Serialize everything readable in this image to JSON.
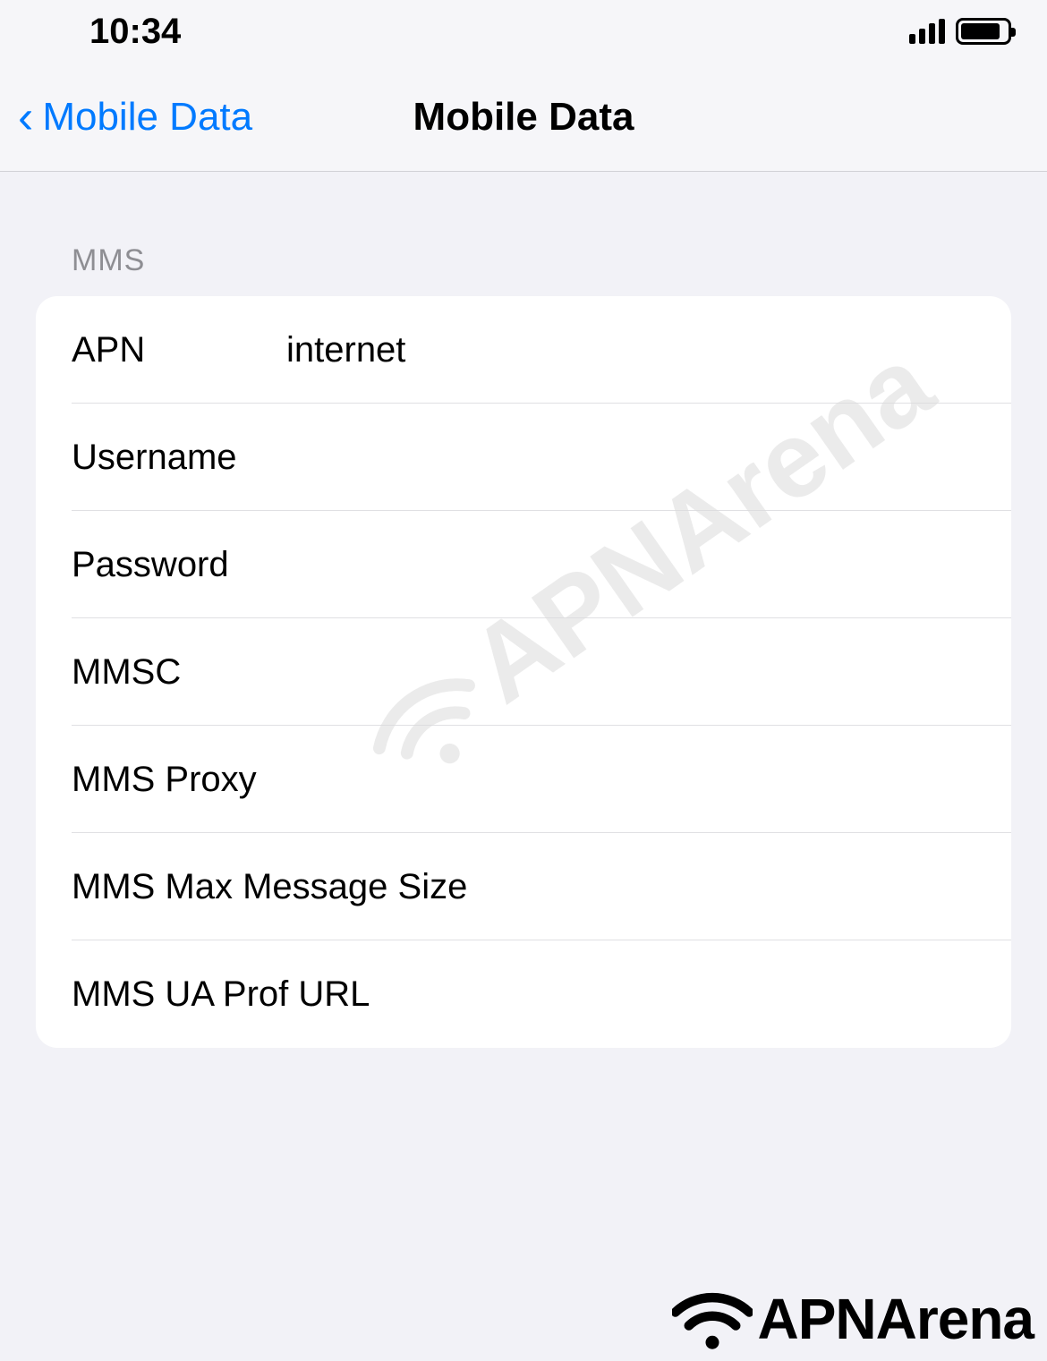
{
  "statusBar": {
    "time": "10:34"
  },
  "navBar": {
    "backLabel": "Mobile Data",
    "title": "Mobile Data"
  },
  "section": {
    "header": "MMS",
    "rows": {
      "apn": {
        "label": "APN",
        "value": "internet"
      },
      "username": {
        "label": "Username",
        "value": ""
      },
      "password": {
        "label": "Password",
        "value": ""
      },
      "mmsc": {
        "label": "MMSC",
        "value": ""
      },
      "mmsProxy": {
        "label": "MMS Proxy",
        "value": ""
      },
      "mmsMaxSize": {
        "label": "MMS Max Message Size",
        "value": ""
      },
      "mmsUaProf": {
        "label": "MMS UA Prof URL",
        "value": ""
      }
    }
  },
  "watermark": "APNArena",
  "footer": "APNArena"
}
